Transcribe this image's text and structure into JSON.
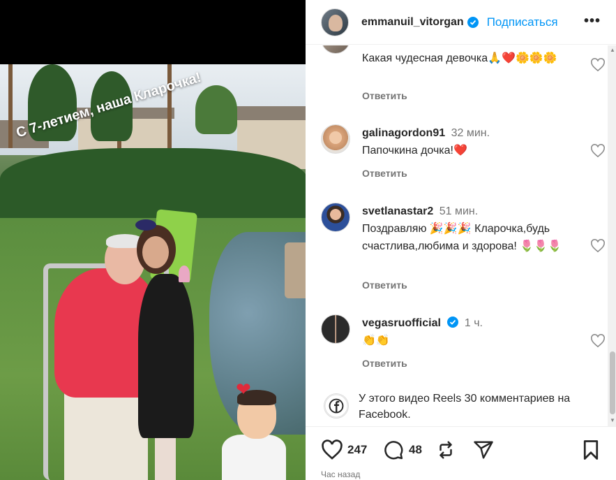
{
  "post": {
    "caption_overlay": "С 7-летием, наша Кларочка!"
  },
  "header": {
    "username": "emmanuil_vitorgan",
    "follow_label": "Подписаться",
    "more_label": "•••"
  },
  "comments": [
    {
      "username": "",
      "time": "",
      "text": "Какая чудесная девочка🙏❤️🌼🌼🌼",
      "reply_label": "Ответить",
      "verified": false
    },
    {
      "username": "galinagordon91",
      "time": "32 мин.",
      "text": "Папочкина дочка!❤️",
      "reply_label": "Ответить",
      "verified": false
    },
    {
      "username": "svetlanastar2",
      "time": "51 мин.",
      "text": "Поздравляю 🎉🎉🎉 Кларочка,будь счастлива,любима и здорова! 🌷🌷🌷",
      "reply_label": "Ответить",
      "verified": false
    },
    {
      "username": "vegasruofficial",
      "time": "1 ч.",
      "text": "👏👏",
      "reply_label": "Ответить",
      "verified": true
    }
  ],
  "facebook_note": "У этого видео Reels 30 комментариев на Facebook.",
  "actions": {
    "likes": "247",
    "comments": "48"
  },
  "timestamp": "Час назад",
  "colors": {
    "accent": "#0095f6",
    "text": "#262626",
    "muted": "#737373",
    "heart_red": "#e0243b"
  },
  "icons": [
    "more-icon",
    "verified-icon",
    "like-icon",
    "comment-icon",
    "repost-icon",
    "share-icon",
    "save-icon",
    "facebook-icon"
  ]
}
